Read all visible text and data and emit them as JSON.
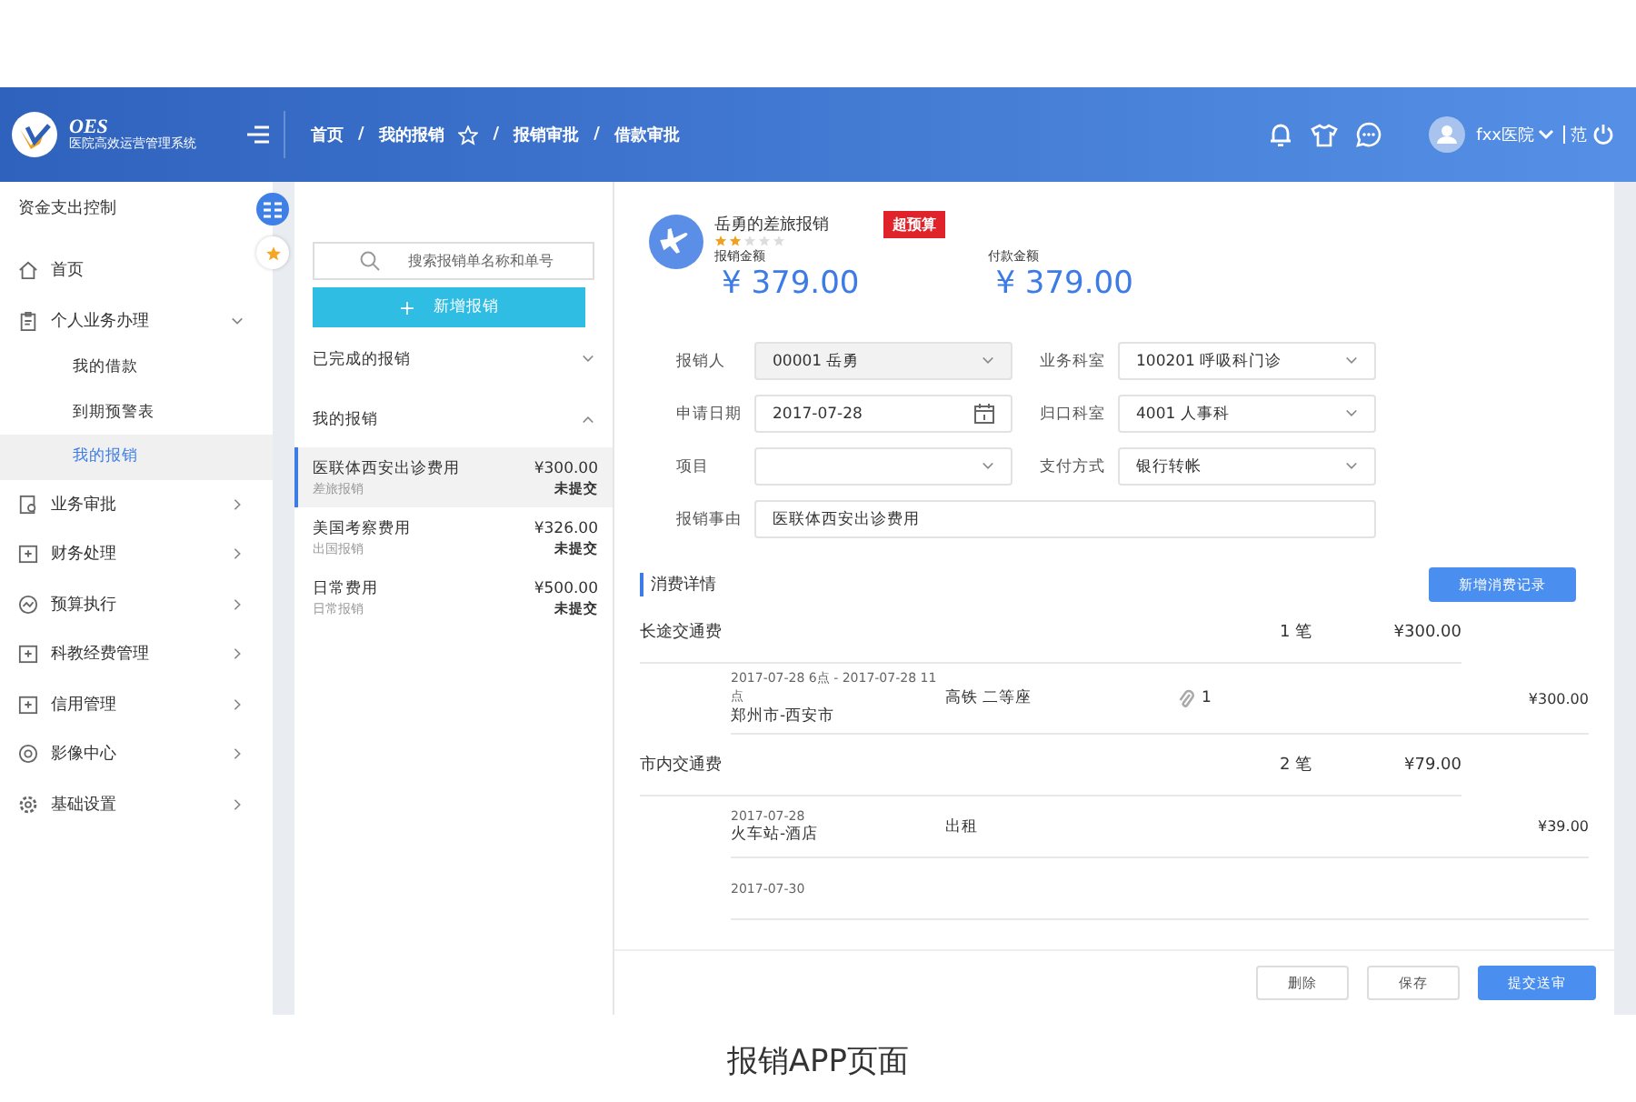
{
  "header": {
    "logo_title": "OES",
    "logo_subtitle": "医院高效运营管理系统",
    "breadcrumb": [
      {
        "label": "首页",
        "kind": "link"
      },
      {
        "label": "我的报销",
        "kind": "star"
      },
      {
        "label": "报销审批",
        "kind": "link"
      },
      {
        "label": "借款审批",
        "kind": "link"
      }
    ],
    "separator": "/",
    "user": "fxx医院",
    "user_suffix": "范"
  },
  "sidebar": {
    "title": "资金支出控制",
    "items": [
      {
        "label": "首页",
        "has_arrow": false
      },
      {
        "label": "个人业务办理",
        "has_arrow": true,
        "expanded": true,
        "children": [
          {
            "label": "我的借款",
            "selected": false
          },
          {
            "label": "到期预警表",
            "selected": false
          },
          {
            "label": "我的报销",
            "selected": true
          }
        ]
      },
      {
        "label": "业务审批",
        "has_arrow": true,
        "expanded": false
      },
      {
        "label": "财务处理",
        "has_arrow": true,
        "expanded": false
      },
      {
        "label": "预算执行",
        "has_arrow": true,
        "expanded": false
      },
      {
        "label": "科教经费管理",
        "has_arrow": true,
        "expanded": false
      },
      {
        "label": "信用管理",
        "has_arrow": true,
        "expanded": false
      },
      {
        "label": "影像中心",
        "has_arrow": true,
        "expanded": false
      },
      {
        "label": "基础设置",
        "has_arrow": true,
        "expanded": false
      }
    ]
  },
  "list_panel": {
    "search": {
      "placeholder": "搜索报销单名称和单号"
    },
    "new_button": "新增报销",
    "new_button_icon": "+",
    "groups": [
      {
        "title": "已完成的报销",
        "expanded": false
      },
      {
        "title": "我的报销",
        "expanded": true,
        "items": [
          {
            "name": "医联体西安出诊费用",
            "type": "差旅报销",
            "amount": "¥300.00",
            "status": "未提交",
            "selected": true
          },
          {
            "name": "美国考察费用",
            "type": "出国报销",
            "amount": "¥326.00",
            "status": "未提交",
            "selected": false
          },
          {
            "name": "日常费用",
            "type": "日常报销",
            "amount": "¥500.00",
            "status": "未提交",
            "selected": false
          }
        ]
      }
    ]
  },
  "detail": {
    "title": "岳勇的差旅报销",
    "badge": "超预算",
    "stars": 2,
    "amounts": [
      {
        "label": "报销金额",
        "value": "¥ 379.00"
      },
      {
        "label": "付款金额",
        "value": "¥ 379.00"
      }
    ],
    "fields": [
      {
        "label": "报销人",
        "value": "00001 岳勇",
        "kind": "select",
        "disabled": true
      },
      {
        "label": "业务科室",
        "value": "100201 呼吸科门诊",
        "kind": "select",
        "disabled": false
      },
      {
        "label": "申请日期",
        "value": "2017-07-28",
        "kind": "date",
        "disabled": false
      },
      {
        "label": "归口科室",
        "value": "4001 人事科",
        "kind": "select",
        "disabled": false
      },
      {
        "label": "项目",
        "kind": "select",
        "disabled": false
      },
      {
        "label": "支付方式",
        "value": "银行转帐",
        "kind": "select",
        "disabled": false
      },
      {
        "label": "报销事由",
        "value": "医联体西安出诊费用",
        "kind": "text",
        "disabled": false
      }
    ],
    "section_title": "消费详情",
    "add_button": "新增消费记录",
    "categories": [
      {
        "name": "长途交通费",
        "count": "1 笔",
        "total": "¥300.00",
        "records": [
          {
            "time": "2017-07-28 6点 - 2017-07-28 11点",
            "route": "郑州市-西安市",
            "mode": "高铁 二等座",
            "attachments": "1",
            "amount": "¥300.00"
          }
        ]
      },
      {
        "name": "市内交通费",
        "count": "2 笔",
        "total": "¥79.00",
        "records": [
          {
            "time": "2017-07-28",
            "route": "火车站-酒店",
            "mode": "出租",
            "amount": "¥39.00"
          },
          {
            "time": "2017-07-30"
          }
        ]
      }
    ],
    "buttons": [
      {
        "label": "删除",
        "kind": "default"
      },
      {
        "label": "保存",
        "kind": "default"
      },
      {
        "label": "提交送审",
        "kind": "primary"
      }
    ]
  },
  "caption": "报销APP页面"
}
